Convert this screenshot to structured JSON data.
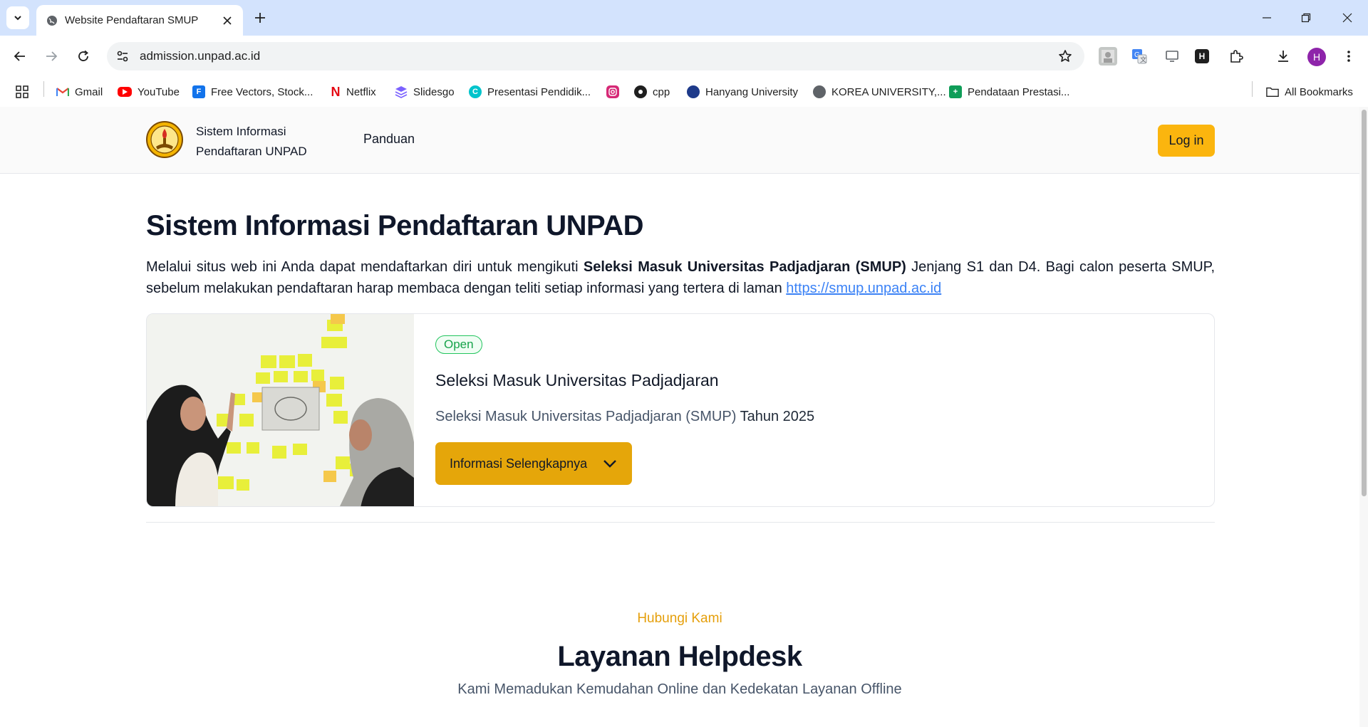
{
  "browser": {
    "tab_title": "Website Pendaftaran SMUP",
    "url": "admission.unpad.ac.id",
    "profile_initial": "H",
    "bookmarks": [
      {
        "label": "Gmail",
        "icon": "gmail-icon"
      },
      {
        "label": "YouTube",
        "icon": "youtube-icon"
      },
      {
        "label": "Free Vectors, Stock...",
        "icon": "freepik-icon"
      },
      {
        "label": "Netflix",
        "icon": "netflix-icon"
      },
      {
        "label": "Slidesgo",
        "icon": "slidesgo-icon"
      },
      {
        "label": "Presentasi Pendidik...",
        "icon": "canva-icon"
      },
      {
        "label": "",
        "icon": "instagram-icon"
      },
      {
        "label": "cpp",
        "icon": "github-icon"
      },
      {
        "label": "Hanyang University",
        "icon": "hanyang-icon"
      },
      {
        "label": "KOREA UNIVERSITY,...",
        "icon": "globe-icon"
      },
      {
        "label": "Pendataan Prestasi...",
        "icon": "sheets-icon"
      }
    ],
    "all_bookmarks": "All Bookmarks"
  },
  "site": {
    "brand_line1": "Sistem Informasi",
    "brand_line2": "Pendaftaran UNPAD",
    "nav_panduan": "Panduan",
    "login": "Log in"
  },
  "hero": {
    "title": "Sistem Informasi Pendaftaran UNPAD",
    "desc_part1": "Melalui situs web ini Anda dapat mendaftarkan diri untuk mengikuti ",
    "desc_bold": "Seleksi Masuk Universitas Padjadjaran (SMUP)",
    "desc_part2": " Jenjang S1 dan D4. Bagi calon peserta SMUP, sebelum melakukan pendaftaran harap membaca dengan teliti setiap informasi yang tertera di laman ",
    "desc_link": "https://smup.unpad.ac.id"
  },
  "card": {
    "badge": "Open",
    "title": "Seleksi Masuk Universitas Padjadjaran",
    "sub_muted": "Seleksi Masuk Universitas Padjadjaran (SMUP)",
    "sub_year": " Tahun 2025",
    "button": "Informasi Selengkapnya"
  },
  "contact": {
    "eyebrow": "Hubungi Kami",
    "title": "Layanan Helpdesk",
    "subtitle": "Kami Memadukan Kemudahan Online dan Kedekatan Layanan Offline"
  },
  "colors": {
    "chrome_tabbar": "#d3e3fd",
    "accent_yellow": "#fbb50e",
    "button_amber": "#e5a60a",
    "badge_green": "#16a34a",
    "link_blue": "#3b82f6",
    "eyebrow_orange": "#e59f0b"
  }
}
